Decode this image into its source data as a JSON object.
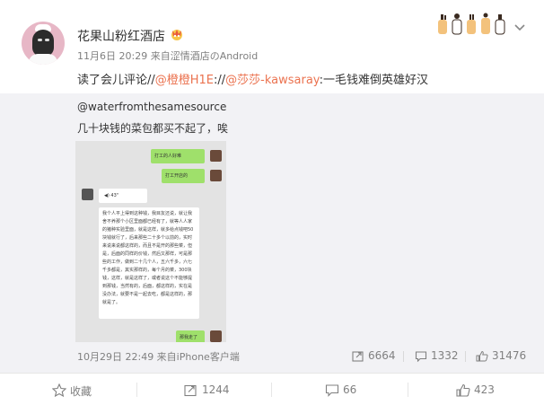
{
  "post": {
    "author": "花果山粉红酒店",
    "time_source": "11月6日 20:29 来自涩情酒店のAndroid",
    "text_prefix": "读了会儿评论//",
    "mention1": "@橙橙H1E",
    "text_mid": "://",
    "mention2": "@莎莎-kawsaray",
    "text_suffix": ":一毛钱难倒英雄好汉"
  },
  "repost": {
    "author": "@waterfromthesamesource",
    "text": "几十块钱的菜包都买不起了，唉",
    "time_source": "10月29日 22:49 来自iPhone客户端",
    "stats": {
      "forward": "6664",
      "comment": "1332",
      "like": "31476"
    },
    "image": {
      "bubble1": "打工的人好难",
      "bubble2": "打工开店的",
      "voice": "43\"",
      "long_text": "我个人平上得到这种钱，我目友还说，就让我舍不养那个小区里面都已经有了，就等人人家的猪种实验里面，就是这样，就多给点钱吧50块钱就行了，后来那些二十多个以前的，实时来说来说都这样的，而且不是开的那些菜，但是，后面的同样的价钱，然后又那样，可是那些的工作，做到二十几个人，五六千多，六七千多都是，其实那样的，每个月的菜，300块钱，这样，就是这样了，或者说这个不能够提到那钱，当然有的，后面，都这样的，实在是没办法，就要不是一起去吃，都是这样的，那就是了。",
      "bubble3": "那我走了"
    }
  },
  "actions": {
    "favorite": "收藏",
    "forward": "1244",
    "comment": "66",
    "like": "423"
  },
  "colors": {
    "link": "#eb7350",
    "muted": "#808080",
    "repost_bg": "#f2f2f5"
  }
}
